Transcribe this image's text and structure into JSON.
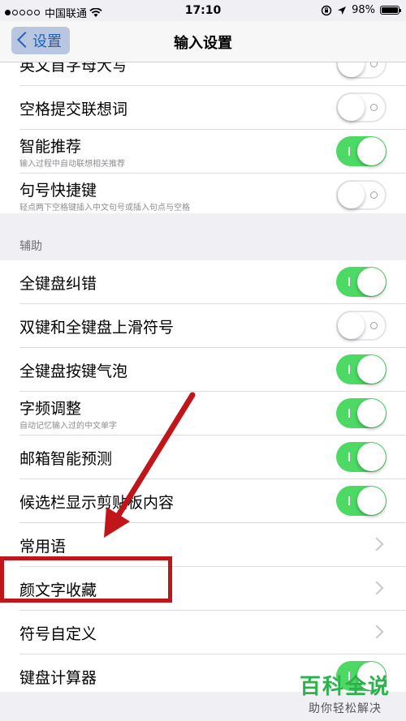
{
  "status_bar": {
    "carrier": "中国联通",
    "time": "17:10",
    "battery": "98%",
    "battery_level": 0.98
  },
  "nav": {
    "back_label": "设置",
    "title": "输入设置"
  },
  "group1": {
    "rows": [
      {
        "label": "英文首字母大写",
        "type": "toggle",
        "on": false
      },
      {
        "label": "空格提交联想词",
        "type": "toggle",
        "on": false
      },
      {
        "label": "智能推荐",
        "sub": "输入过程中自动联想相关推荐",
        "type": "toggle",
        "on": true
      },
      {
        "label": "句号快捷键",
        "sub": "轻点两下空格键插入中文句号或插入句点与空格",
        "type": "toggle",
        "on": false
      }
    ]
  },
  "section2_header": "辅助",
  "group2": {
    "rows": [
      {
        "label": "全键盘纠错",
        "type": "toggle",
        "on": true
      },
      {
        "label": "双键和全键盘上滑符号",
        "type": "toggle",
        "on": false
      },
      {
        "label": "全键盘按键气泡",
        "type": "toggle",
        "on": true
      },
      {
        "label": "字频调整",
        "sub": "自动记忆输入过的中文单字",
        "type": "toggle",
        "on": true
      },
      {
        "label": "邮箱智能预测",
        "type": "toggle",
        "on": true
      },
      {
        "label": "候选栏显示剪贴板内容",
        "type": "toggle",
        "on": true
      },
      {
        "label": "常用语",
        "type": "chevron"
      },
      {
        "label": "颜文字收藏",
        "type": "chevron"
      },
      {
        "label": "符号自定义",
        "type": "chevron"
      },
      {
        "label": "键盘计算器",
        "type": "toggle",
        "on": true
      }
    ]
  },
  "watermark": {
    "main": "百科全说",
    "sub": "助你轻松解决"
  },
  "colors": {
    "toggle_on": "#4cd964",
    "annotation": "#c0161a",
    "nav_blue": "#1f5fbf"
  }
}
